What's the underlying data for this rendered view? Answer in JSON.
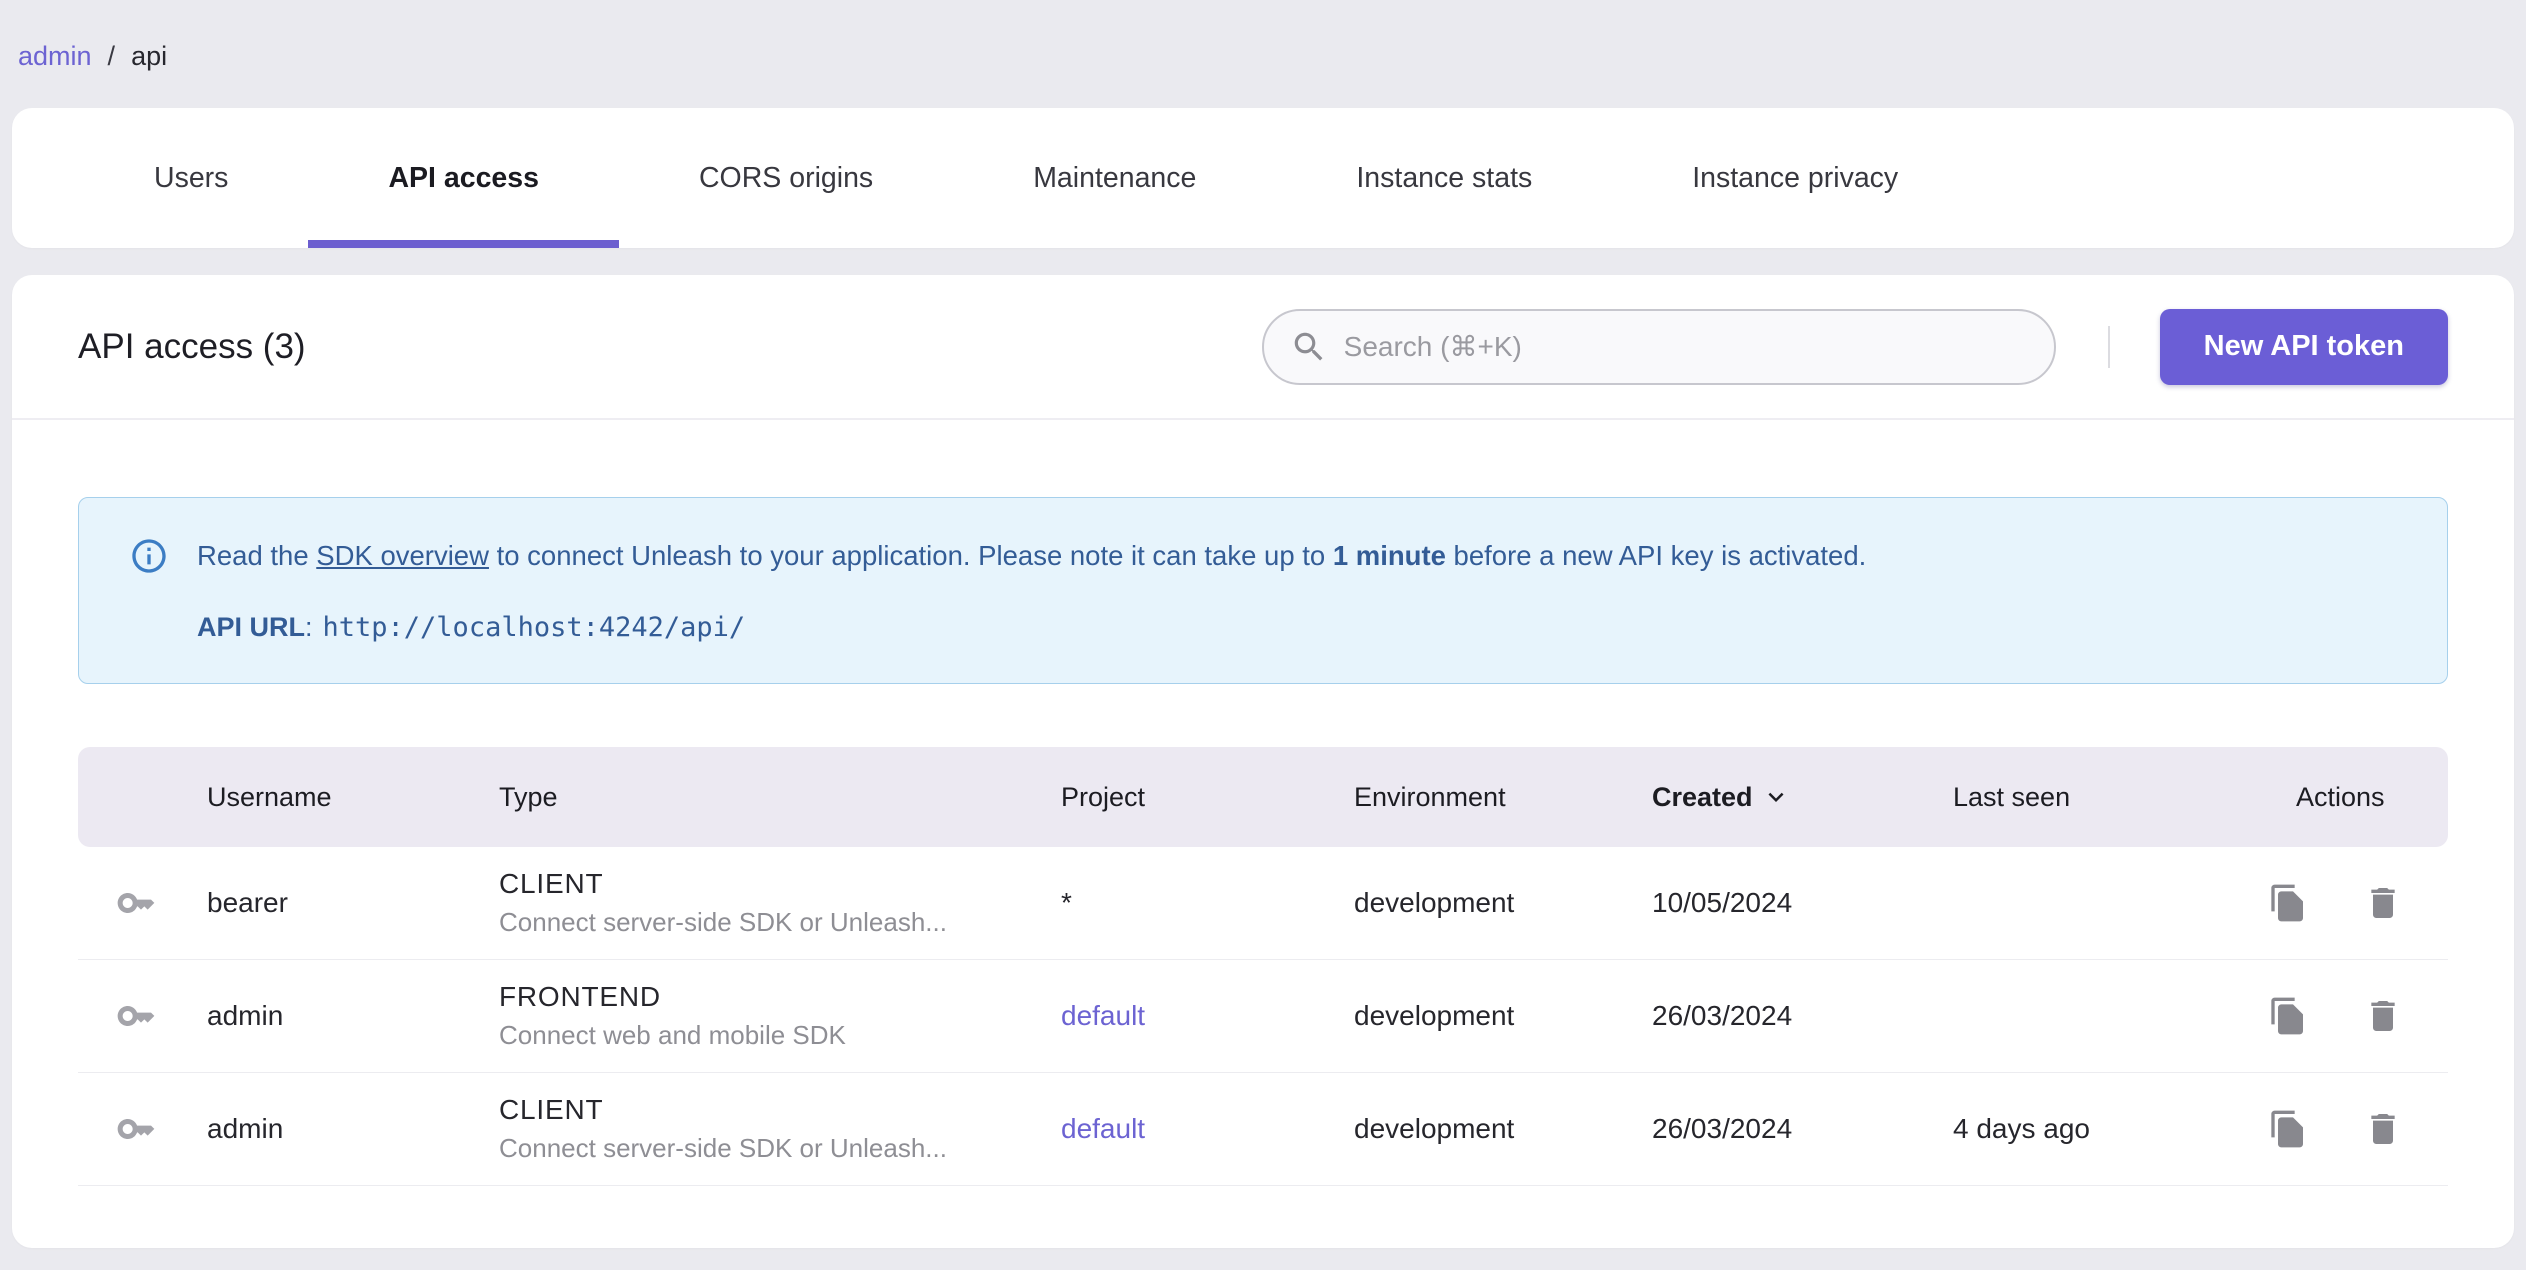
{
  "breadcrumb": {
    "separator": "/",
    "items": [
      {
        "label": "admin",
        "is_link": true
      },
      {
        "label": "api",
        "is_link": false
      }
    ]
  },
  "tabs": [
    {
      "label": "Users",
      "active": false
    },
    {
      "label": "API access",
      "active": true
    },
    {
      "label": "CORS origins",
      "active": false
    },
    {
      "label": "Maintenance",
      "active": false
    },
    {
      "label": "Instance stats",
      "active": false
    },
    {
      "label": "Instance privacy",
      "active": false
    }
  ],
  "header": {
    "title": "API access (3)",
    "search_placeholder": "Search (⌘+K)",
    "new_token_button": "New API token"
  },
  "alert": {
    "line1": {
      "prefix": "Read the ",
      "link": "SDK overview",
      "middle": " to connect Unleash to your application. Please note it can take up to ",
      "bold": "1 minute",
      "suffix": " before a new API key is activated."
    },
    "line2": {
      "label": "API URL",
      "separator": ":",
      "url": "http://localhost:4242/api/"
    }
  },
  "table": {
    "columns": [
      "Username",
      "Type",
      "Project",
      "Environment",
      "Created",
      "Last seen",
      "Actions"
    ],
    "sorted_column": "Created",
    "sort_direction": "desc",
    "rows": [
      {
        "username": "bearer",
        "type": "CLIENT",
        "type_description": "Connect server-side SDK or Unleash...",
        "project": "*",
        "project_is_link": false,
        "environment": "development",
        "created": "10/05/2024",
        "last_seen": ""
      },
      {
        "username": "admin",
        "type": "FRONTEND",
        "type_description": "Connect web and mobile SDK",
        "project": "default",
        "project_is_link": true,
        "environment": "development",
        "created": "26/03/2024",
        "last_seen": ""
      },
      {
        "username": "admin",
        "type": "CLIENT",
        "type_description": "Connect server-side SDK or Unleash...",
        "project": "default",
        "project_is_link": true,
        "environment": "development",
        "created": "26/03/2024",
        "last_seen": "4 days ago"
      }
    ]
  },
  "icons": {
    "search": "magnifier",
    "info": "circled-i",
    "sort": "chevron-down",
    "token": "key",
    "copy": "file-copy",
    "delete": "trash"
  },
  "colors": {
    "accent": "#6b5ed6",
    "tab_underline": "#6c5ecf",
    "link": "#6c63d2",
    "page_bg": "#eaeaef",
    "card_bg": "#ffffff",
    "alert_bg": "#e7f4fc",
    "alert_border": "#a6d0ec",
    "alert_text": "#335c96",
    "table_header_bg": "#ece9f2",
    "icon_gray": "#8d8d93"
  }
}
